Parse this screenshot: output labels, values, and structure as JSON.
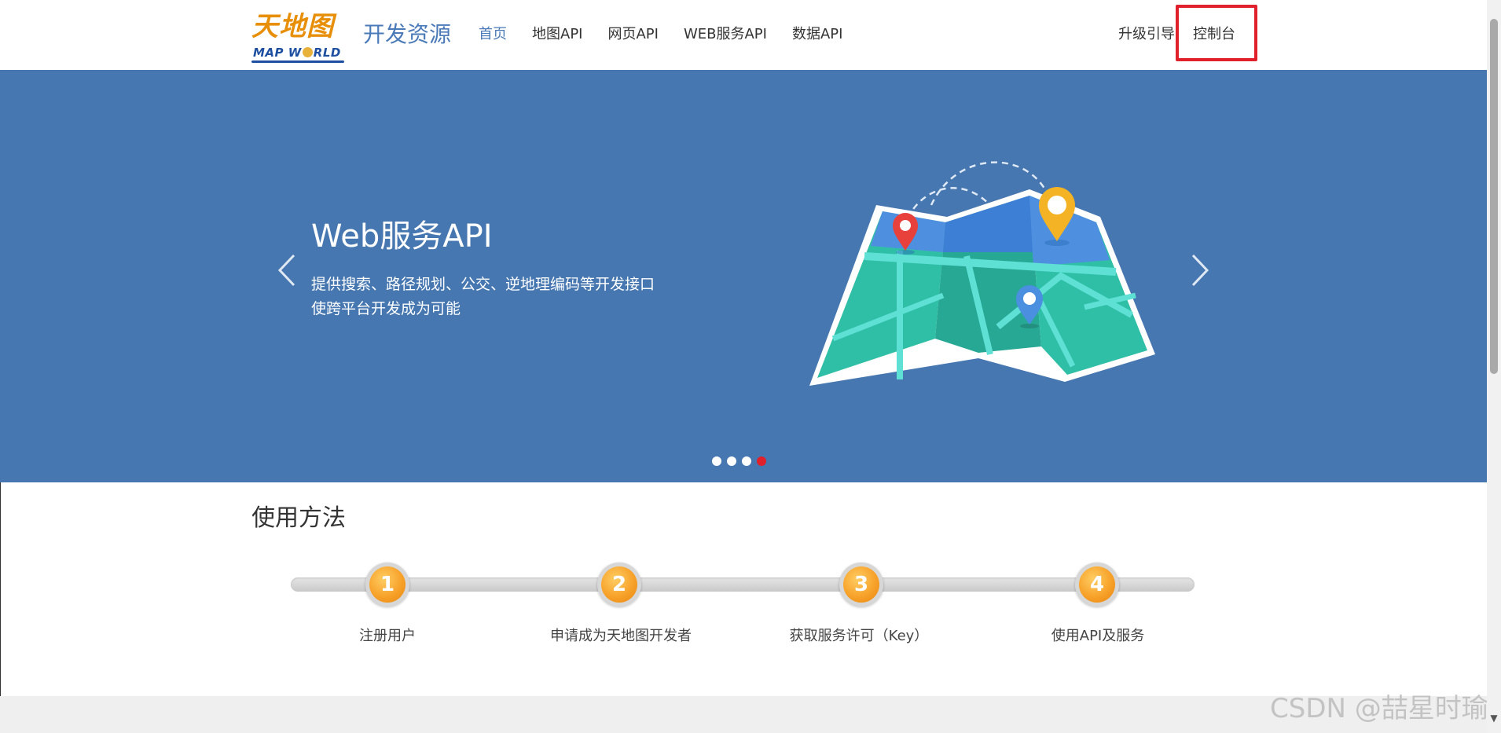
{
  "header": {
    "logo_cn": "天地图",
    "logo_en_left": "MAP W",
    "logo_en_right": "RLD",
    "brand": "开发资源",
    "nav": [
      {
        "label": "首页",
        "active": true
      },
      {
        "label": "地图API",
        "active": false
      },
      {
        "label": "网页API",
        "active": false
      },
      {
        "label": "WEB服务API",
        "active": false
      },
      {
        "label": "数据API",
        "active": false
      }
    ],
    "upgrade_guide": "升级引导",
    "console": "控制台",
    "highlight_color": "#e0212b"
  },
  "banner": {
    "title": "Web服务API",
    "desc_line1": "提供搜索、路径规划、公交、逆地理编码等开发接口",
    "desc_line2": "使跨平台开发成为可能",
    "background_color": "#4677b0",
    "slide_count": 4,
    "active_slide": 4,
    "prev_icon": "chevron-left-icon",
    "next_icon": "chevron-right-icon"
  },
  "usage": {
    "title": "使用方法",
    "steps": [
      {
        "num": "1",
        "label": "注册用户"
      },
      {
        "num": "2",
        "label": "申请成为天地图开发者"
      },
      {
        "num": "3",
        "label": "获取服务许可（Key）"
      },
      {
        "num": "4",
        "label": "使用API及服务"
      }
    ]
  },
  "watermark": "CSDN @喆星时瑜"
}
